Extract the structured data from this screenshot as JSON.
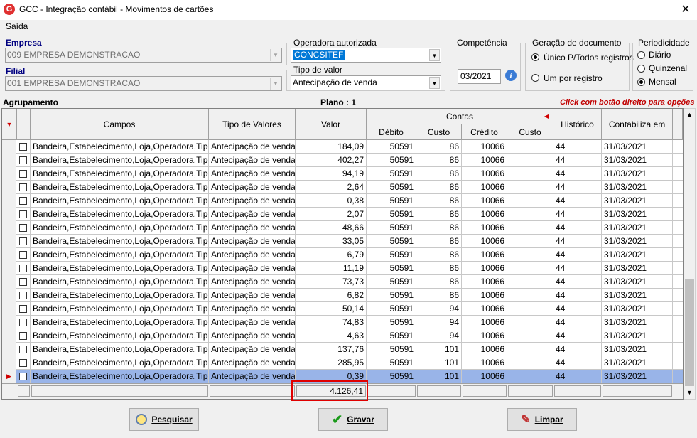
{
  "window": {
    "title": "GCC - Integração contábil - Movimentos de cartões",
    "logo_letter": "G",
    "close_glyph": "✕"
  },
  "menu": {
    "saida": "Saída"
  },
  "empresa": {
    "label": "Empresa",
    "value": "009 EMPRESA DEMONSTRACAO"
  },
  "filial": {
    "label": "Filial",
    "value": "001 EMPRESA DEMONSTRACAO"
  },
  "operadora": {
    "legend": "Operadora autorizada",
    "value": "CONCSITEF"
  },
  "tipo_valor": {
    "legend": "Tipo de valor",
    "value": "Antecipação de venda"
  },
  "competencia": {
    "legend": "Competência",
    "value": "03/2021",
    "info_glyph": "i"
  },
  "geracao": {
    "legend": "Geração de documento",
    "options": [
      "Único P/Todos registros",
      "Um por registro"
    ],
    "selected": 0
  },
  "periodicidade": {
    "legend": "Periodicidade",
    "options": [
      "Diário",
      "Quinzenal",
      "Mensal"
    ],
    "selected": 2
  },
  "grid": {
    "agrupamento": "Agrupamento",
    "plano": "Plano : 1",
    "hint": "Click com botão direito para opções",
    "headers": {
      "campos": "Campos",
      "tipo": "Tipo de Valores",
      "valor": "Valor",
      "contas": "Contas",
      "debito": "Débito",
      "custo1": "Custo",
      "credito": "Crédito",
      "custo2": "Custo",
      "historico": "Histórico",
      "contabiliza": "Contabiliza em"
    },
    "rows": [
      {
        "campos": "Bandeira,Estabelecimento,Loja,Operadora,Tipo",
        "tipo": "Antecipação de venda",
        "valor": "184,09",
        "debito": "50591",
        "custo1": "86",
        "credito": "10066",
        "custo2": "",
        "historico": "44",
        "contabiliza": "31/03/2021"
      },
      {
        "campos": "Bandeira,Estabelecimento,Loja,Operadora,Tipo",
        "tipo": "Antecipação de venda",
        "valor": "402,27",
        "debito": "50591",
        "custo1": "86",
        "credito": "10066",
        "custo2": "",
        "historico": "44",
        "contabiliza": "31/03/2021"
      },
      {
        "campos": "Bandeira,Estabelecimento,Loja,Operadora,Tipo",
        "tipo": "Antecipação de venda",
        "valor": "94,19",
        "debito": "50591",
        "custo1": "86",
        "credito": "10066",
        "custo2": "",
        "historico": "44",
        "contabiliza": "31/03/2021"
      },
      {
        "campos": "Bandeira,Estabelecimento,Loja,Operadora,Tipo",
        "tipo": "Antecipação de venda",
        "valor": "2,64",
        "debito": "50591",
        "custo1": "86",
        "credito": "10066",
        "custo2": "",
        "historico": "44",
        "contabiliza": "31/03/2021"
      },
      {
        "campos": "Bandeira,Estabelecimento,Loja,Operadora,Tipo",
        "tipo": "Antecipação de venda",
        "valor": "0,38",
        "debito": "50591",
        "custo1": "86",
        "credito": "10066",
        "custo2": "",
        "historico": "44",
        "contabiliza": "31/03/2021"
      },
      {
        "campos": "Bandeira,Estabelecimento,Loja,Operadora,Tipo",
        "tipo": "Antecipação de venda",
        "valor": "2,07",
        "debito": "50591",
        "custo1": "86",
        "credito": "10066",
        "custo2": "",
        "historico": "44",
        "contabiliza": "31/03/2021"
      },
      {
        "campos": "Bandeira,Estabelecimento,Loja,Operadora,Tipo",
        "tipo": "Antecipação de venda",
        "valor": "48,66",
        "debito": "50591",
        "custo1": "86",
        "credito": "10066",
        "custo2": "",
        "historico": "44",
        "contabiliza": "31/03/2021"
      },
      {
        "campos": "Bandeira,Estabelecimento,Loja,Operadora,Tipo",
        "tipo": "Antecipação de venda",
        "valor": "33,05",
        "debito": "50591",
        "custo1": "86",
        "credito": "10066",
        "custo2": "",
        "historico": "44",
        "contabiliza": "31/03/2021"
      },
      {
        "campos": "Bandeira,Estabelecimento,Loja,Operadora,Tipo",
        "tipo": "Antecipação de venda",
        "valor": "6,79",
        "debito": "50591",
        "custo1": "86",
        "credito": "10066",
        "custo2": "",
        "historico": "44",
        "contabiliza": "31/03/2021"
      },
      {
        "campos": "Bandeira,Estabelecimento,Loja,Operadora,Tipo",
        "tipo": "Antecipação de venda",
        "valor": "11,19",
        "debito": "50591",
        "custo1": "86",
        "credito": "10066",
        "custo2": "",
        "historico": "44",
        "contabiliza": "31/03/2021"
      },
      {
        "campos": "Bandeira,Estabelecimento,Loja,Operadora,Tipo",
        "tipo": "Antecipação de venda",
        "valor": "73,73",
        "debito": "50591",
        "custo1": "86",
        "credito": "10066",
        "custo2": "",
        "historico": "44",
        "contabiliza": "31/03/2021"
      },
      {
        "campos": "Bandeira,Estabelecimento,Loja,Operadora,Tipo",
        "tipo": "Antecipação de venda",
        "valor": "6,82",
        "debito": "50591",
        "custo1": "86",
        "credito": "10066",
        "custo2": "",
        "historico": "44",
        "contabiliza": "31/03/2021"
      },
      {
        "campos": "Bandeira,Estabelecimento,Loja,Operadora,Tipo",
        "tipo": "Antecipação de venda",
        "valor": "50,14",
        "debito": "50591",
        "custo1": "94",
        "credito": "10066",
        "custo2": "",
        "historico": "44",
        "contabiliza": "31/03/2021"
      },
      {
        "campos": "Bandeira,Estabelecimento,Loja,Operadora,Tipo",
        "tipo": "Antecipação de venda",
        "valor": "74,83",
        "debito": "50591",
        "custo1": "94",
        "credito": "10066",
        "custo2": "",
        "historico": "44",
        "contabiliza": "31/03/2021"
      },
      {
        "campos": "Bandeira,Estabelecimento,Loja,Operadora,Tipo",
        "tipo": "Antecipação de venda",
        "valor": "4,63",
        "debito": "50591",
        "custo1": "94",
        "credito": "10066",
        "custo2": "",
        "historico": "44",
        "contabiliza": "31/03/2021"
      },
      {
        "campos": "Bandeira,Estabelecimento,Loja,Operadora,Tipo",
        "tipo": "Antecipação de venda",
        "valor": "137,76",
        "debito": "50591",
        "custo1": "101",
        "credito": "10066",
        "custo2": "",
        "historico": "44",
        "contabiliza": "31/03/2021"
      },
      {
        "campos": "Bandeira,Estabelecimento,Loja,Operadora,Tipo",
        "tipo": "Antecipação de venda",
        "valor": "285,95",
        "debito": "50591",
        "custo1": "101",
        "credito": "10066",
        "custo2": "",
        "historico": "44",
        "contabiliza": "31/03/2021"
      },
      {
        "campos": "Bandeira,Estabelecimento,Loja,Operadora,Tipo",
        "tipo": "Antecipação de venda",
        "valor": "0,39",
        "debito": "50591",
        "custo1": "101",
        "credito": "10066",
        "custo2": "",
        "historico": "44",
        "contabiliza": "31/03/2021",
        "selected": true
      }
    ],
    "total": "4.126,41"
  },
  "buttons": {
    "pesquisar": "Pesquisar",
    "gravar": "Gravar",
    "limpar": "Limpar"
  },
  "colors": {
    "accent": "#0078d7",
    "selected_row": "#99b4e8",
    "hint": "#c00000",
    "label": "#000080",
    "highlight_box": "#e00000"
  }
}
